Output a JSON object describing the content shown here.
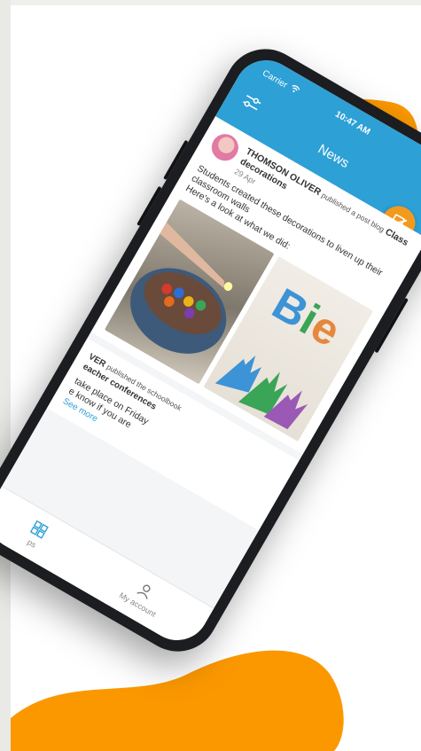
{
  "colors": {
    "accent": "#f29a1e",
    "header": "#2da0d6",
    "phone_body": "#1c1d20",
    "background_orange": "#fb9800"
  },
  "status_bar": {
    "carrier": "Carrier",
    "time": "10:47 AM"
  },
  "header": {
    "title": "News",
    "filter_icon": "sliders-icon",
    "compose_icon": "edit-icon"
  },
  "posts": [
    {
      "author": "THOMSON OLIVER",
      "action": "published a post blog",
      "title": "Class decorations",
      "date": "29 Apr",
      "body_1": "Students created these decorations to liven up their classroom walls",
      "body_2": "Here's a look at what we did:",
      "photo_letters": [
        "B",
        "i",
        "e"
      ]
    },
    {
      "author": "VER",
      "action": "published the schoolbook",
      "title": "eacher conferences",
      "body": "take place on Friday",
      "body_2": "e know if you are",
      "see_more": "See more"
    }
  ],
  "bottom_nav": [
    {
      "label": "ps",
      "icon": "grid-icon"
    },
    {
      "label": "My account",
      "icon": "user-icon"
    }
  ]
}
